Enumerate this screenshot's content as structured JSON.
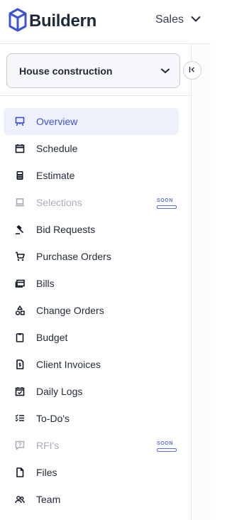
{
  "brand": {
    "name": "Buildern",
    "color": "#3b53d6"
  },
  "header": {
    "workspace": "Sales"
  },
  "project": {
    "selected": "House construction"
  },
  "colors": {
    "active_text": "#3b53d6",
    "active_bg": "#eef1fb",
    "disabled_text": "#a8adb7",
    "soon_badge": "#5a70d8"
  },
  "nav": {
    "items": [
      {
        "label": "Overview",
        "icon": "presentation-icon",
        "active": true
      },
      {
        "label": "Schedule",
        "icon": "calendar-icon"
      },
      {
        "label": "Estimate",
        "icon": "calculator-icon"
      },
      {
        "label": "Selections",
        "icon": "laptop-icon",
        "disabled": true,
        "badge": "SOON"
      },
      {
        "label": "Bid Requests",
        "icon": "gavel-icon"
      },
      {
        "label": "Purchase Orders",
        "icon": "cart-icon"
      },
      {
        "label": "Bills",
        "icon": "bills-icon"
      },
      {
        "label": "Change Orders",
        "icon": "shapes-icon"
      },
      {
        "label": "Budget",
        "icon": "clipboard-icon"
      },
      {
        "label": "Client Invoices",
        "icon": "invoice-icon"
      },
      {
        "label": "Daily Logs",
        "icon": "calendar-check-icon"
      },
      {
        "label": "To-Do's",
        "icon": "checklist-icon"
      },
      {
        "label": "RFI's",
        "icon": "question-icon",
        "disabled": true,
        "badge": "SOON"
      },
      {
        "label": "Files",
        "icon": "file-icon"
      },
      {
        "label": "Team",
        "icon": "team-icon"
      }
    ]
  }
}
